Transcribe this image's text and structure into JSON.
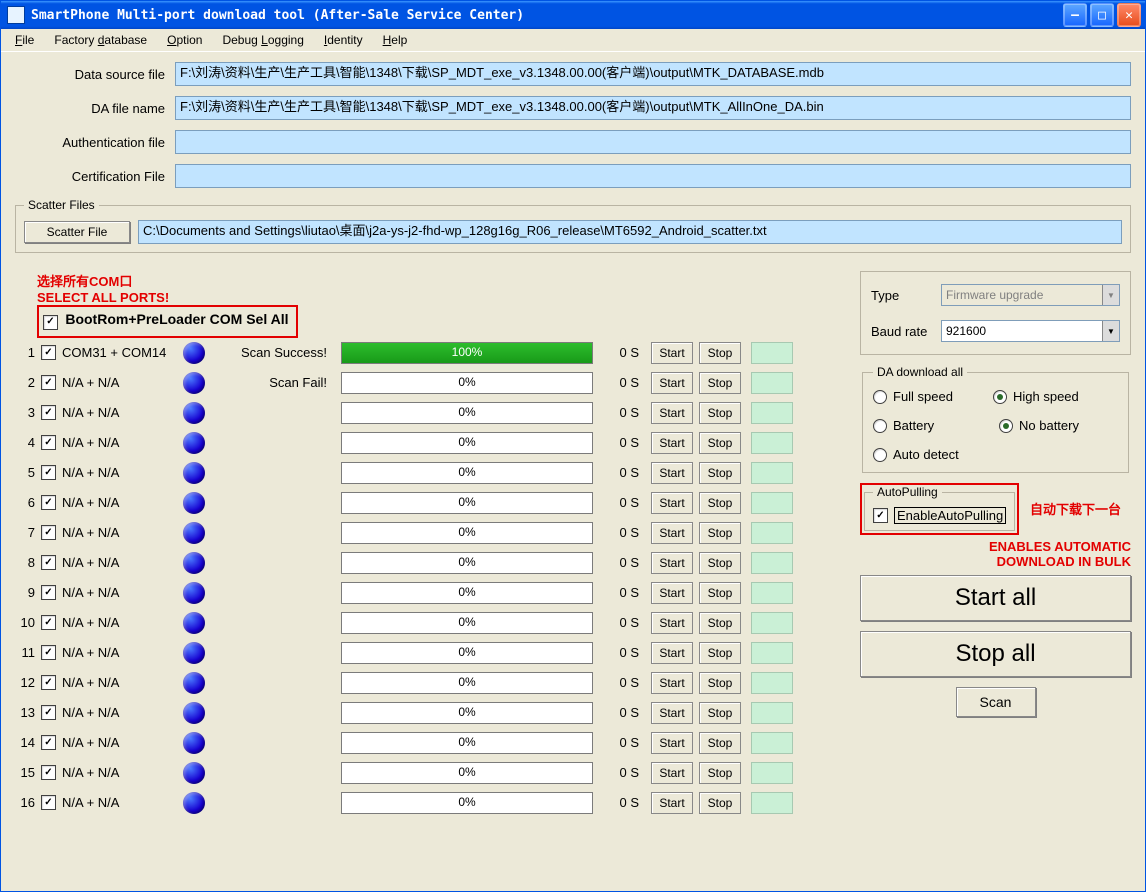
{
  "title": "SmartPhone Multi-port download tool (After-Sale Service Center)",
  "menu": {
    "file": "File",
    "factory": "Factory database",
    "option": "Option",
    "debug": "Debug Logging",
    "identity": "Identity",
    "help": "Help"
  },
  "files": {
    "data_source_lbl": "Data source file",
    "data_source_val": "F:\\刘涛\\资料\\生产\\生产工具\\智能\\1348\\下载\\SP_MDT_exe_v3.1348.00.00(客户端)\\output\\MTK_DATABASE.mdb",
    "da_lbl": "DA file name",
    "da_val": "F:\\刘涛\\资料\\生产\\生产工具\\智能\\1348\\下载\\SP_MDT_exe_v3.1348.00.00(客户端)\\output\\MTK_AllInOne_DA.bin",
    "auth_lbl": "Authentication file",
    "auth_val": "",
    "cert_lbl": "Certification File",
    "cert_val": ""
  },
  "scatter": {
    "legend": "Scatter Files",
    "btn": "Scatter File",
    "val": "C:\\Documents and Settings\\liutao\\桌面\\j2a-ys-j2-fhd-wp_128g16g_R06_release\\MT6592_Android_scatter.txt"
  },
  "annotations": {
    "sel_cn": "选择所有COM口",
    "sel_en": "SELECT ALL PORTS!",
    "auto_cn": "自动下载下一台",
    "auto_en1": "ENABLES AUTOMATIC",
    "auto_en2": "DOWNLOAD IN BULK"
  },
  "selall_label": "BootRom+PreLoader COM Sel All",
  "scan_success": "Scan Success!",
  "scan_fail": "Scan Fail!",
  "seconds": "0 S",
  "start": "Start",
  "stop": "Stop",
  "ports": [
    {
      "idx": 1,
      "name": "COM31 + COM14",
      "pct": "100%",
      "fill": 100,
      "green": true,
      "status": "Scan Success!"
    },
    {
      "idx": 2,
      "name": "N/A + N/A",
      "pct": "0%",
      "fill": 0,
      "green": false,
      "status": "Scan Fail!"
    },
    {
      "idx": 3,
      "name": "N/A + N/A",
      "pct": "0%",
      "fill": 0,
      "green": false,
      "status": ""
    },
    {
      "idx": 4,
      "name": "N/A + N/A",
      "pct": "0%",
      "fill": 0,
      "green": false,
      "status": ""
    },
    {
      "idx": 5,
      "name": "N/A + N/A",
      "pct": "0%",
      "fill": 0,
      "green": false,
      "status": ""
    },
    {
      "idx": 6,
      "name": "N/A + N/A",
      "pct": "0%",
      "fill": 0,
      "green": false,
      "status": ""
    },
    {
      "idx": 7,
      "name": "N/A + N/A",
      "pct": "0%",
      "fill": 0,
      "green": false,
      "status": ""
    },
    {
      "idx": 8,
      "name": "N/A + N/A",
      "pct": "0%",
      "fill": 0,
      "green": false,
      "status": ""
    },
    {
      "idx": 9,
      "name": "N/A + N/A",
      "pct": "0%",
      "fill": 0,
      "green": false,
      "status": ""
    },
    {
      "idx": 10,
      "name": "N/A + N/A",
      "pct": "0%",
      "fill": 0,
      "green": false,
      "status": ""
    },
    {
      "idx": 11,
      "name": "N/A + N/A",
      "pct": "0%",
      "fill": 0,
      "green": false,
      "status": ""
    },
    {
      "idx": 12,
      "name": "N/A + N/A",
      "pct": "0%",
      "fill": 0,
      "green": false,
      "status": ""
    },
    {
      "idx": 13,
      "name": "N/A + N/A",
      "pct": "0%",
      "fill": 0,
      "green": false,
      "status": ""
    },
    {
      "idx": 14,
      "name": "N/A + N/A",
      "pct": "0%",
      "fill": 0,
      "green": false,
      "status": ""
    },
    {
      "idx": 15,
      "name": "N/A + N/A",
      "pct": "0%",
      "fill": 0,
      "green": false,
      "status": ""
    },
    {
      "idx": 16,
      "name": "N/A + N/A",
      "pct": "0%",
      "fill": 0,
      "green": false,
      "status": ""
    }
  ],
  "right": {
    "type_lbl": "Type",
    "type_val": "Firmware upgrade",
    "baud_lbl": "Baud rate",
    "baud_val": "921600",
    "da_legend": "DA download all",
    "full": "Full speed",
    "high": "High speed",
    "batt": "Battery",
    "nobatt": "No battery",
    "auto": "Auto detect",
    "ap_legend": "AutoPulling",
    "ap_chk": "EnableAutoPulling",
    "start_all": "Start all",
    "stop_all": "Stop all",
    "scan": "Scan"
  }
}
